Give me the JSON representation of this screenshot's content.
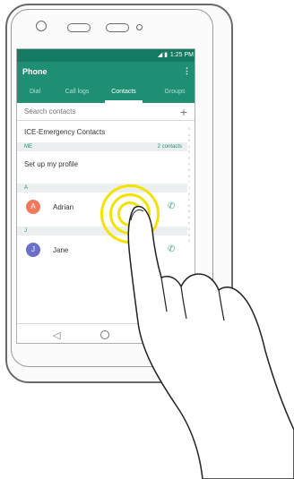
{
  "status": {
    "time": "1:25 PM",
    "icons": "◢ ▮"
  },
  "app": {
    "title": "Phone",
    "menu_glyph": "⋮"
  },
  "tabs": [
    {
      "label": "Dial"
    },
    {
      "label": "Call logs"
    },
    {
      "label": "Contacts",
      "active": true
    },
    {
      "label": "Groups"
    }
  ],
  "search": {
    "placeholder": "Search contacts",
    "add_glyph": "+"
  },
  "ice": {
    "label": "ICE-Emergency Contacts"
  },
  "me_section": {
    "header": "ME",
    "count": "2 contacts"
  },
  "profile": {
    "label": "Set up my profile"
  },
  "sections": [
    {
      "header": "A",
      "contacts": [
        {
          "initial": "A",
          "name": "Adrian",
          "color": "#f07a5b"
        }
      ]
    },
    {
      "header": "J",
      "contacts": [
        {
          "initial": "J",
          "name": "Jane",
          "color": "#6a6fc7"
        }
      ]
    }
  ],
  "index_letters": [
    "G",
    "A",
    "B",
    "C",
    "D",
    "E",
    "F",
    "G",
    "H",
    "I",
    "J",
    "K",
    "L",
    "M",
    "N",
    "O",
    "P",
    "Q",
    "R",
    "S"
  ],
  "nav": {
    "back_glyph": "◁"
  },
  "colors": {
    "accent": "#1f8f74",
    "status_bar": "#147a62",
    "touch_ring": "#f2e200"
  }
}
